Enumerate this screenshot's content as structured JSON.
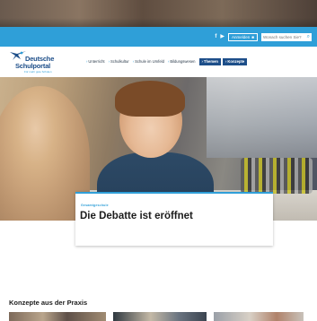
{
  "util_bar": {
    "social_icons": [
      "facebook-icon",
      "youtube-icon"
    ],
    "social_glyphs": [
      "f",
      "▶"
    ],
    "login_label": "Anmelden",
    "login_icon_glyph": "■",
    "search_placeholder": "Wonach suchen Sie?",
    "search_icon_glyph": "⌕",
    "accent_color": "#2f9fd8"
  },
  "header": {
    "logo": {
      "line1": "Deutsche",
      "line2": "Schulportal",
      "tagline": "Für mehr gute Schulen"
    },
    "nav": [
      {
        "label": "Unterricht",
        "active": false
      },
      {
        "label": "Schulkultur",
        "active": false
      },
      {
        "label": "Schule im Umfeld",
        "active": false
      },
      {
        "label": "Bildungswesen",
        "active": false
      },
      {
        "label": "Themen",
        "active": true
      },
      {
        "label": "Konzepte",
        "active": true
      }
    ],
    "nav_active_color": "#1d4e89"
  },
  "teaser": {
    "kicker": "Gesamtgeschule",
    "headline": "Die Debatte ist eröffnet"
  },
  "section": {
    "title": "Konzepte aus der Praxis"
  }
}
